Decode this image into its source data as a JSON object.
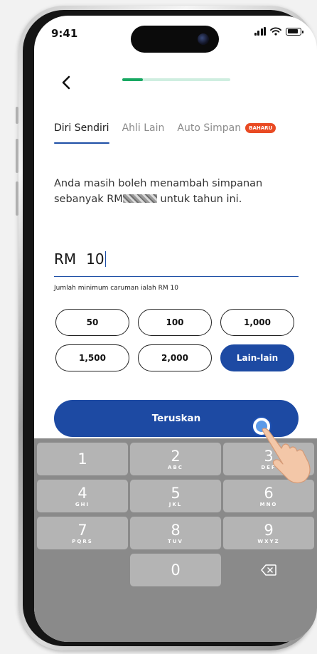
{
  "status_bar": {
    "time": "9:41"
  },
  "nav": {
    "progress_percent": 19
  },
  "tabs": [
    {
      "label": "Diri Sendiri",
      "active": true
    },
    {
      "label": "Ahli Lain",
      "active": false
    },
    {
      "label": "Auto Simpan",
      "active": false,
      "badge": "BAHARU"
    }
  ],
  "info": {
    "line_start": "Anda masih boleh menambah simpanan sebanyak RM",
    "line_end": " untuk tahun ini."
  },
  "amount": {
    "currency": "RM",
    "value": "10"
  },
  "min_note": "Jumlah minimum caruman ialah RM 10",
  "quick_amounts": [
    {
      "label": "50",
      "active": false
    },
    {
      "label": "100",
      "active": false
    },
    {
      "label": "1,000",
      "active": false
    },
    {
      "label": "1,500",
      "active": false
    },
    {
      "label": "2,000",
      "active": false
    },
    {
      "label": "Lain-lain",
      "active": true
    }
  ],
  "continue_label": "Teruskan",
  "keypad": [
    {
      "num": "1",
      "letters": ""
    },
    {
      "num": "2",
      "letters": "ABC"
    },
    {
      "num": "3",
      "letters": "DEF"
    },
    {
      "num": "4",
      "letters": "GHI"
    },
    {
      "num": "5",
      "letters": "JKL"
    },
    {
      "num": "6",
      "letters": "MNO"
    },
    {
      "num": "7",
      "letters": "PQRS"
    },
    {
      "num": "8",
      "letters": "TUV"
    },
    {
      "num": "9",
      "letters": "WXYZ"
    },
    {
      "num": "0",
      "letters": ""
    }
  ],
  "icons": {
    "back": "chevron-left-icon",
    "backspace": "backspace-icon",
    "signal": "cellular-signal-icon",
    "wifi": "wifi-icon",
    "battery": "battery-icon"
  },
  "colors": {
    "primary": "#1d4aa3",
    "progress": "#18a862",
    "badge": "#e94a23",
    "keypad": "#8a8a8a"
  }
}
